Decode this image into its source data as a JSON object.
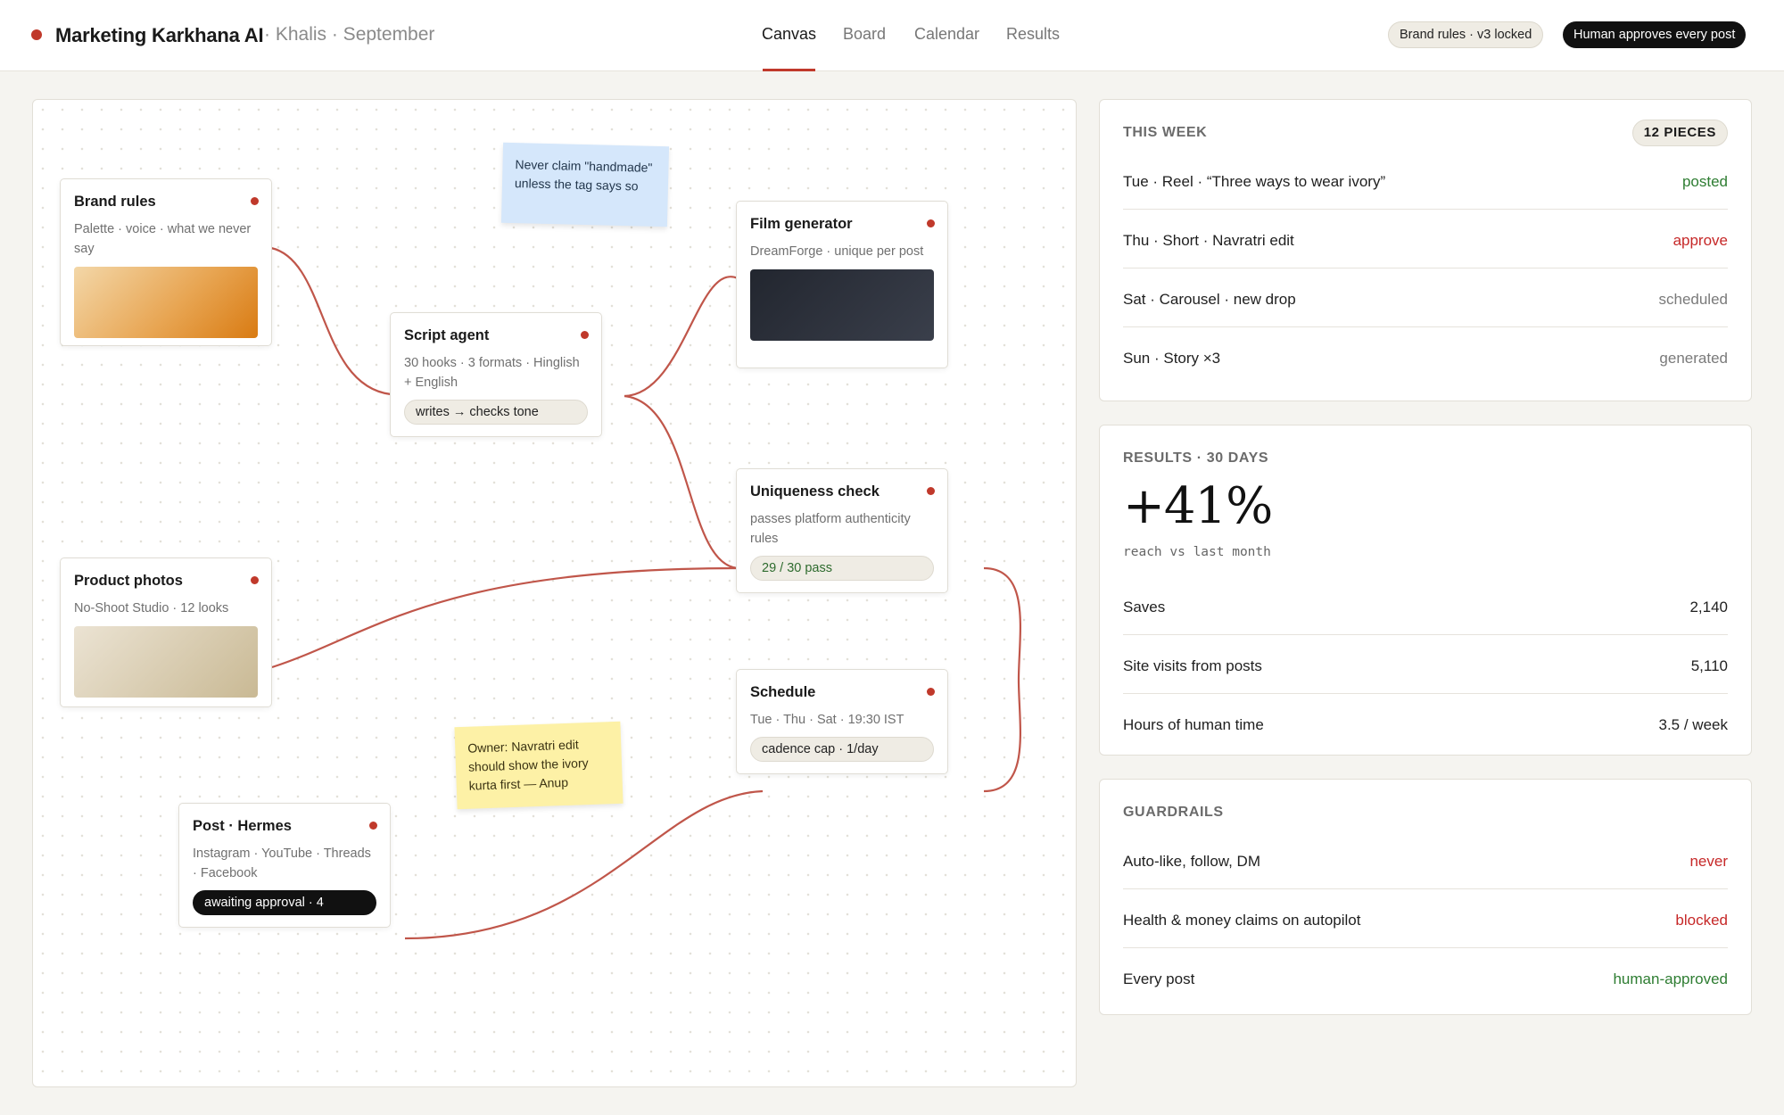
{
  "header": {
    "title": "Marketing Karkhana AI",
    "subtitle": "· Khalis · September",
    "tabs": [
      {
        "label": "Canvas",
        "active": true
      },
      {
        "label": "Board",
        "active": false
      },
      {
        "label": "Calendar",
        "active": false
      },
      {
        "label": "Results",
        "active": false
      }
    ],
    "brand_rules_pill": "Brand rules · v3 locked",
    "approval_pill": "Human approves every post"
  },
  "canvas": {
    "nodes": {
      "brand_rules": {
        "title": "Brand rules",
        "desc": "Palette · voice · what we never say"
      },
      "script_agent": {
        "title": "Script agent",
        "desc": "30 hooks · 3 formats · Hinglish + English",
        "chip": "writes → checks tone"
      },
      "film_generator": {
        "title": "Film generator",
        "desc": "DreamForge · unique per post"
      },
      "uniqueness_check": {
        "title": "Uniqueness check",
        "desc": "passes platform authenticity rules",
        "chip": "29 / 30 pass"
      },
      "product_photos": {
        "title": "Product photos",
        "desc": "No-Shoot Studio · 12 looks"
      },
      "schedule": {
        "title": "Schedule",
        "desc": "Tue · Thu · Sat · 19:30 IST",
        "chip": "cadence cap · 1/day"
      },
      "post_hermes": {
        "title": "Post · Hermes",
        "desc": "Instagram · YouTube · Threads · Facebook",
        "chip": "awaiting approval · 4"
      }
    },
    "notes": {
      "blue": "Never claim \"handmade\" unless the tag says so",
      "yellow": "Owner: Navratri edit should show the ivory kurta first — Anup"
    }
  },
  "this_week": {
    "heading": "THIS WEEK",
    "count": "12 PIECES",
    "items": [
      {
        "label": "Tue · Reel · “Three ways to wear ivory”",
        "status": "posted"
      },
      {
        "label": "Thu · Short · Navratri edit",
        "status": "approve"
      },
      {
        "label": "Sat · Carousel · new drop",
        "status": "scheduled"
      },
      {
        "label": "Sun · Story ×3",
        "status": "generated"
      }
    ]
  },
  "results": {
    "heading": "RESULTS · 30 DAYS",
    "big_value": "+41%",
    "caption": "reach vs last month",
    "metrics": [
      {
        "label": "Saves",
        "value": "2,140"
      },
      {
        "label": "Site visits from posts",
        "value": "5,110"
      },
      {
        "label": "Hours of human time",
        "value": "3.5 / week"
      }
    ]
  },
  "guardrails": {
    "heading": "GUARDRAILS",
    "items": [
      {
        "label": "Auto-like, follow, DM",
        "value": "never"
      },
      {
        "label": "Health & money claims on autopilot",
        "value": "blocked"
      },
      {
        "label": "Every post",
        "value": "human-approved"
      }
    ]
  },
  "colors": {
    "accent": "#c0392b",
    "wire": "#c0564a",
    "status_green": "#2e7d32",
    "status_red": "#c62828"
  }
}
